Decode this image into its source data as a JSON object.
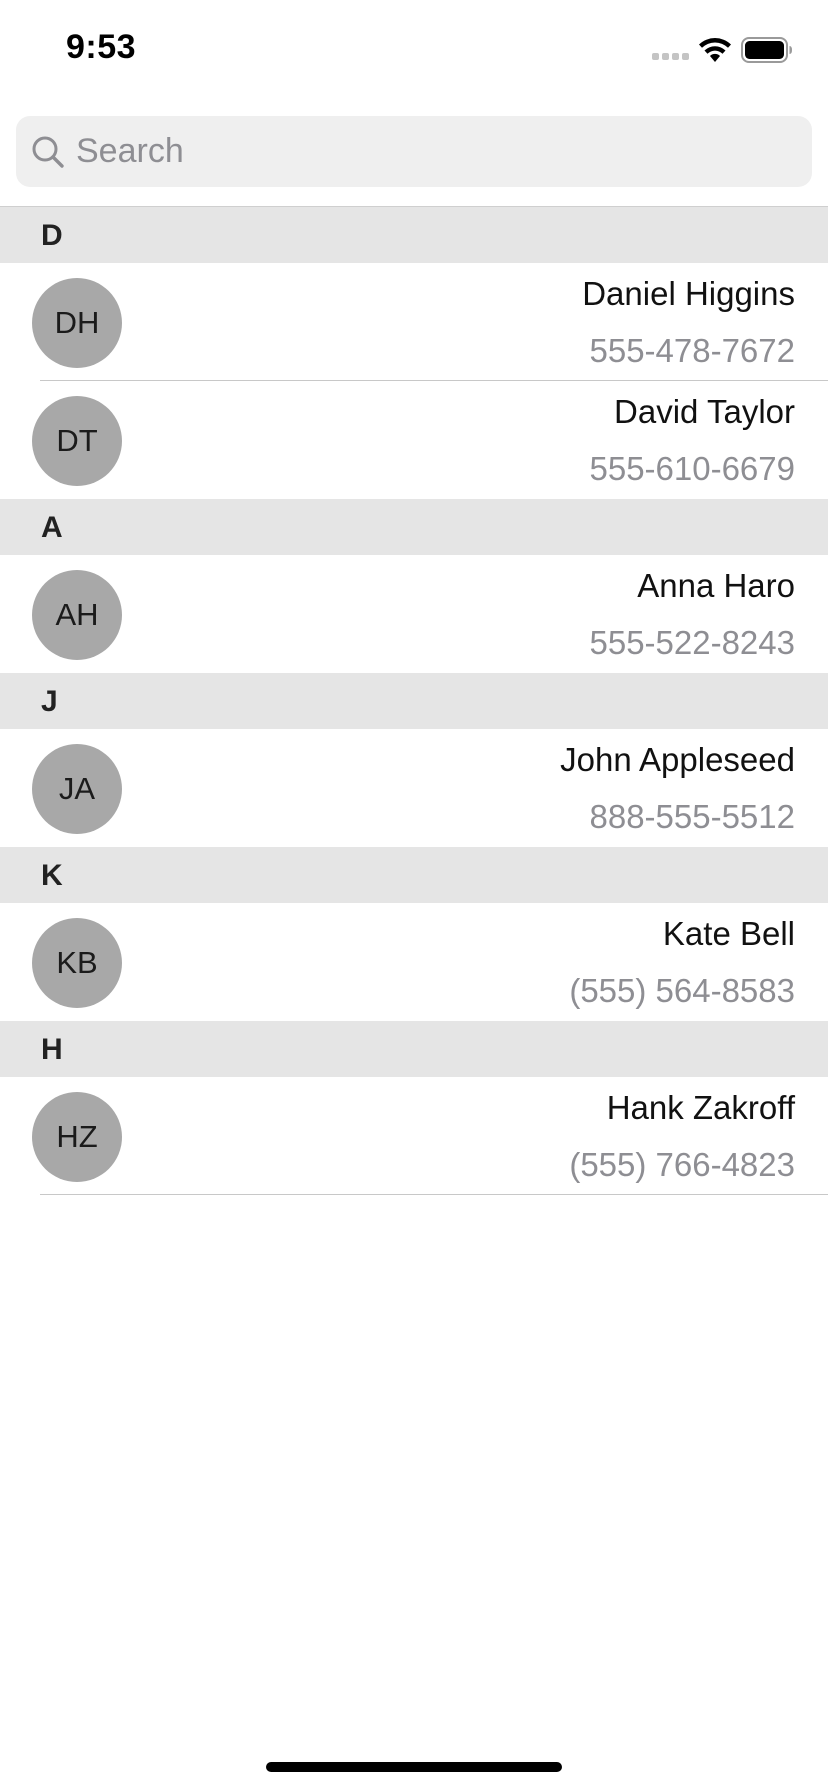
{
  "status_bar": {
    "time": "9:53"
  },
  "search": {
    "placeholder": "Search",
    "value": ""
  },
  "sections": [
    {
      "letter": "D",
      "contacts": [
        {
          "initials": "DH",
          "name": "Daniel Higgins",
          "phone": "555-478-7672"
        },
        {
          "initials": "DT",
          "name": "David Taylor",
          "phone": "555-610-6679"
        }
      ]
    },
    {
      "letter": "A",
      "contacts": [
        {
          "initials": "AH",
          "name": "Anna Haro",
          "phone": "555-522-8243"
        }
      ]
    },
    {
      "letter": "J",
      "contacts": [
        {
          "initials": "JA",
          "name": "John Appleseed",
          "phone": "888-555-5512"
        }
      ]
    },
    {
      "letter": "K",
      "contacts": [
        {
          "initials": "KB",
          "name": "Kate Bell",
          "phone": "(555) 564-8583"
        }
      ]
    },
    {
      "letter": "H",
      "contacts": [
        {
          "initials": "HZ",
          "name": "Hank Zakroff",
          "phone": "(555) 766-4823"
        }
      ]
    }
  ],
  "icons": {
    "search": "magnifier-icon",
    "wifi": "wifi-icon",
    "battery": "battery-icon",
    "signal": "signal-dots-icon"
  },
  "colors": {
    "section_header_bg": "#e5e5e5",
    "avatar_bg": "#a8a8a8",
    "secondary_text": "#8e8e93",
    "search_bg": "#efefef"
  }
}
